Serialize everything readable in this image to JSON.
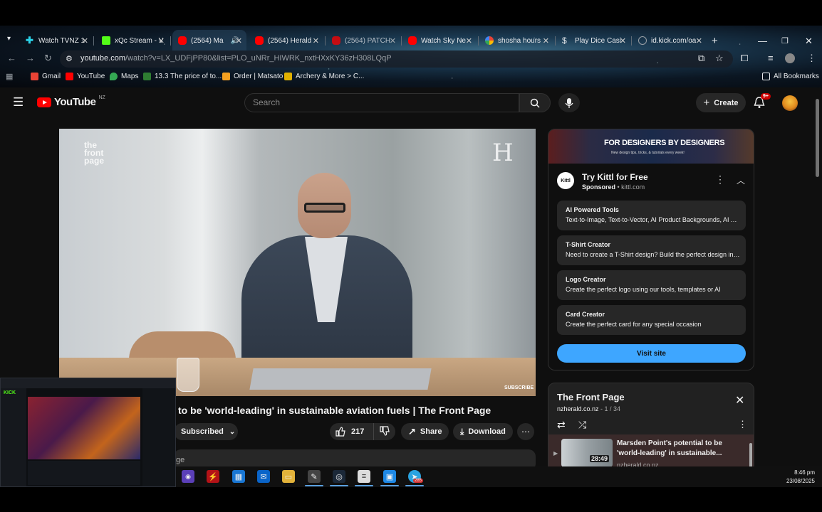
{
  "tabs": [
    {
      "label": "Watch TVNZ 1",
      "color": "#2ad1e6"
    },
    {
      "label": "xQc Stream - V",
      "color": "#53fc18"
    },
    {
      "label": "(2564) Ma",
      "color": "#ff0000"
    },
    {
      "label": "(2564) Herald",
      "color": "#ff0000"
    },
    {
      "label": "(2564) PATCH",
      "color": "#ff0000"
    },
    {
      "label": "Watch Sky Ne",
      "color": "#ff0000"
    },
    {
      "label": "shosha hours",
      "color": "#4285f4"
    },
    {
      "label": "Play Dice Casi",
      "color": "#ffffff"
    },
    {
      "label": "id.kick.com/oa",
      "color": "#9aa0a6"
    }
  ],
  "address_bar": {
    "domain": "youtube.com",
    "path": "/watch?v=LX_UDFjPP80&list=PLO_uNRr_HIWRK_nxtHXxKY36zH308LQqP"
  },
  "bookmarks": [
    {
      "label": "Gmail",
      "color": "#ea4335"
    },
    {
      "label": "YouTube",
      "color": "#ff0000"
    },
    {
      "label": "Maps",
      "color": "#34a853"
    },
    {
      "label": "13.3 The price of to...",
      "color": "#2e7d32"
    },
    {
      "label": "Order | Matsato",
      "color": "#f4a020"
    },
    {
      "label": "Archery & More > C...",
      "color": "#e0b000"
    }
  ],
  "all_bookmarks": "All Bookmarks",
  "youtube": {
    "logo_text": "YouTube",
    "region": "NZ",
    "search_placeholder": "Search",
    "create_label": "Create",
    "notif_badge": "9+"
  },
  "video": {
    "watermark_left": "the\nfront\npage",
    "watermark_right": "H",
    "subscribe_overlay": "SUBSCRIBE",
    "title": "to be 'world-leading' in sustainable aviation fuels | The Front Page",
    "subscribed_label": "Subscribed",
    "likes": "217",
    "share_label": "Share",
    "download_label": "Download",
    "description_fragment": "ge"
  },
  "ad": {
    "banner_title": "FOR DESIGNERS BY DESIGNERS",
    "banner_sub": "New design tips, tricks, & tutorials every week!",
    "logo_text": "Kittl",
    "title": "Try Kittl for Free",
    "sponsored": "Sponsored",
    "domain": "kittl.com",
    "items": [
      {
        "heading": "AI Powered Tools",
        "desc": "Text-to-Image, Text-to-Vector, AI Product Backgrounds, AI Art ..."
      },
      {
        "heading": "T-Shirt Creator",
        "desc": "Need to create a T-Shirt design? Build the perfect design in mi..."
      },
      {
        "heading": "Logo Creator",
        "desc": "Create the perfect logo using our tools, templates or AI"
      },
      {
        "heading": "Card Creator",
        "desc": "Create the perfect card for any special occasion"
      }
    ],
    "visit_label": "Visit site"
  },
  "playlist": {
    "title": "The Front Page",
    "channel": "nzherald.co.nz",
    "position": "1 / 34",
    "current": {
      "title": "Marsden Point's potential to be 'world-leading' in sustainable...",
      "duration": "28:49",
      "channel": "nzherald.co.nz"
    }
  },
  "pip": {
    "brand": "KICK"
  },
  "taskbar": {
    "time": "8:46 pm",
    "date": "23/08/2025",
    "telegram_badge": "285"
  }
}
